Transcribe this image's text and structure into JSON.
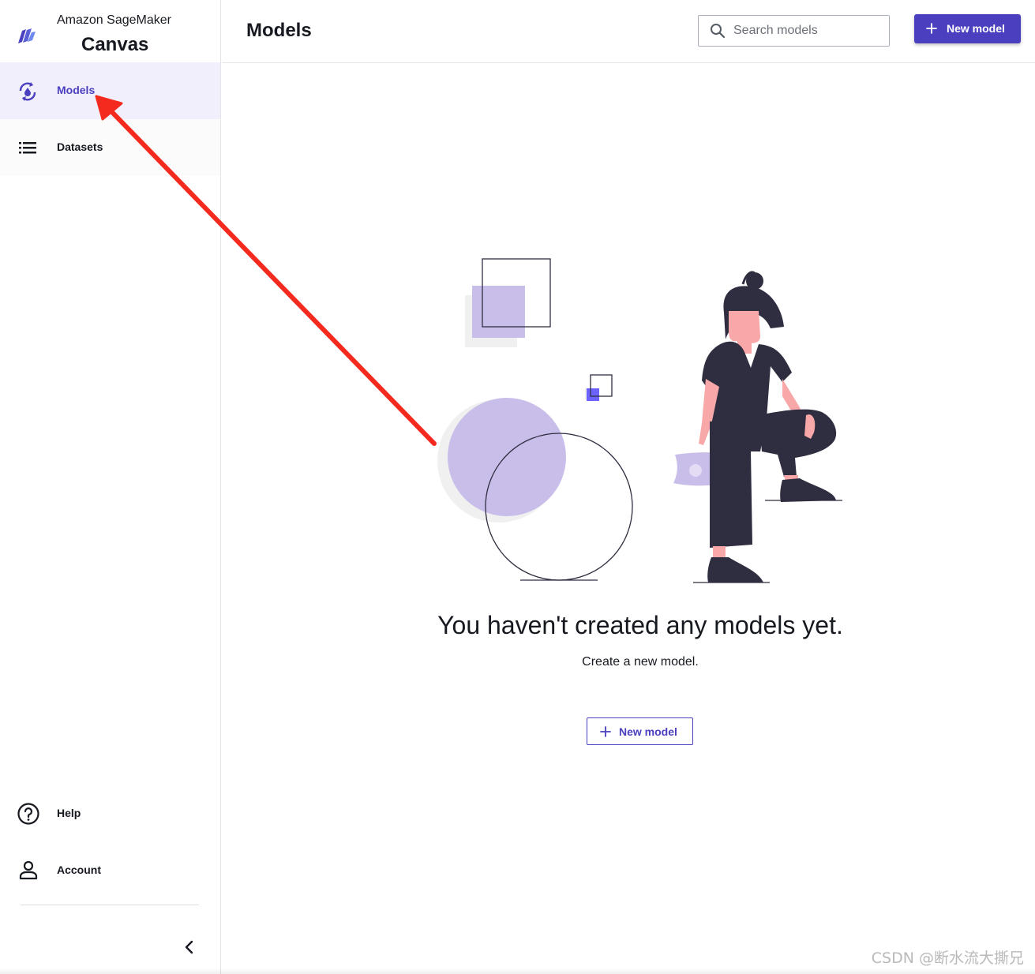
{
  "brand": {
    "subtitle": "Amazon SageMaker",
    "title": "Canvas",
    "logo_icon": "sagemaker-canvas-logo"
  },
  "sidebar": {
    "items": [
      {
        "label": "Models",
        "icon": "models-icon",
        "active": true
      },
      {
        "label": "Datasets",
        "icon": "list-icon",
        "active": false
      }
    ],
    "bottom_items": [
      {
        "label": "Help",
        "icon": "help-icon"
      },
      {
        "label": "Account",
        "icon": "account-icon"
      }
    ],
    "collapse_icon": "chevron-left-icon"
  },
  "header": {
    "title": "Models",
    "search": {
      "placeholder": "Search models",
      "value": ""
    },
    "new_model_label": "New model"
  },
  "empty_state": {
    "title": "You haven't created any models yet.",
    "subtitle": "Create a new model.",
    "button_label": "New model"
  },
  "watermark": "CSDN @断水流大撕兄",
  "colors": {
    "accent": "#4a3fbf",
    "active_bg": "#f1effb",
    "illustration_purple": "#c9bdea",
    "figure_dark": "#2f2e41",
    "skin": "#f8a8a8",
    "annotation_red": "#f52a1e"
  }
}
